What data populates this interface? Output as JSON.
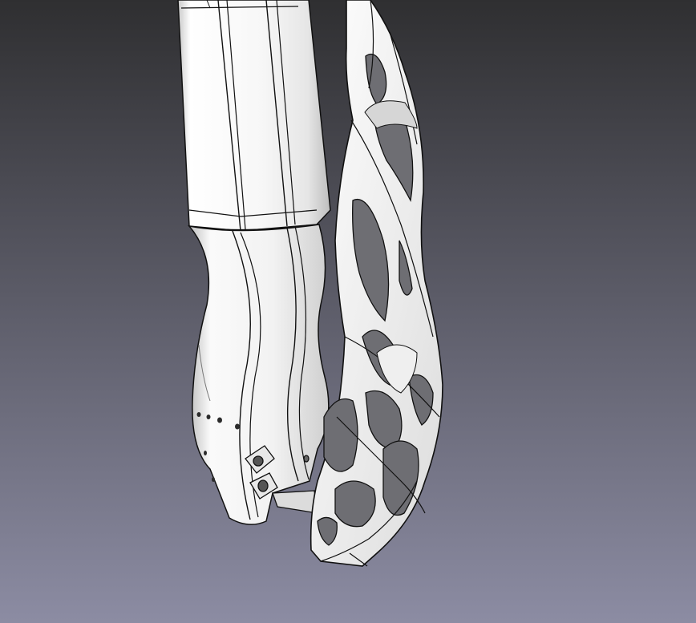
{
  "viewport": {
    "background_top_color": "#2f2f31",
    "background_bottom_color": "#8c8ca3",
    "model_body_color": "#f4f4f4",
    "model_edge_color": "#111111",
    "model_shadow_color": "#9a9a9a"
  },
  "model": {
    "parts": [
      "forearm-socket-upper",
      "forearm-socket-lower",
      "lattice-splint",
      "vent-holes",
      "mount-bosses"
    ]
  }
}
